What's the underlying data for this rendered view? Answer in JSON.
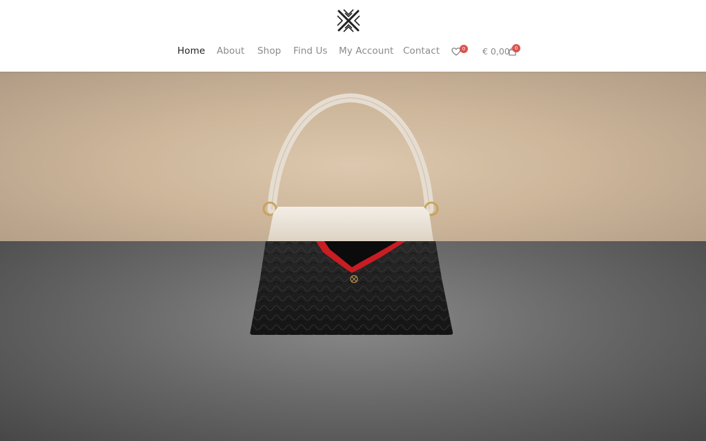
{
  "brand": {
    "logo_icon": "lattice-x-logo-icon"
  },
  "nav": {
    "items": [
      {
        "label": "Home",
        "active": true
      },
      {
        "label": "About",
        "active": false
      },
      {
        "label": "Shop",
        "active": false
      },
      {
        "label": "Find Us",
        "active": false
      },
      {
        "label": "My Account",
        "active": false
      },
      {
        "label": "Contact",
        "active": false
      }
    ],
    "wishlist": {
      "icon": "heart-icon",
      "count": "0"
    },
    "cart": {
      "total": "€ 0,00",
      "icon": "shopping-bag-icon",
      "count": "0"
    }
  },
  "hero": {
    "image": "handbag-product-image",
    "colors": {
      "top": "#d4bfa4",
      "bottom": "#6b6b6b",
      "accent": "#d9534f"
    }
  }
}
